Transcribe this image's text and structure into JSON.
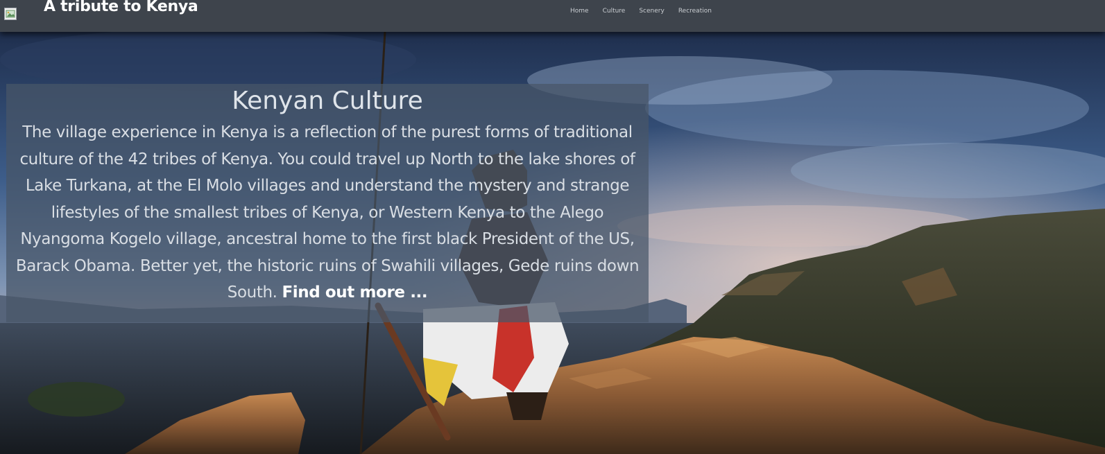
{
  "header": {
    "logo_icon": "broken-image-icon",
    "title": "A tribute to Kenya",
    "nav": [
      {
        "label": "Home"
      },
      {
        "label": "Culture"
      },
      {
        "label": "Scenery"
      },
      {
        "label": "Recreation"
      }
    ]
  },
  "hero": {
    "image": "kenyan-warrior-on-rock-landscape",
    "panel": {
      "title": "Kenyan Culture",
      "body": "The village experience in Kenya is a reflection of the purest forms of traditional culture of the 42 tribes of Kenya. You could travel up North to the lake shores of Lake Turkana, at the El Molo villages and understand the mystery and strange lifestyles of the smallest tribes of Kenya, or Western Kenya to the Alego Nyangoma Kogelo village, ancestral home to the first black President of the US, Barack Obama. Better yet, the historic ruins of Swahili villages, Gede ruins down South.",
      "link": "Find out more ..."
    }
  },
  "colors": {
    "header_bg": "#3e444c",
    "panel_bg": "#485668",
    "text_light": "#dfe4ea"
  }
}
